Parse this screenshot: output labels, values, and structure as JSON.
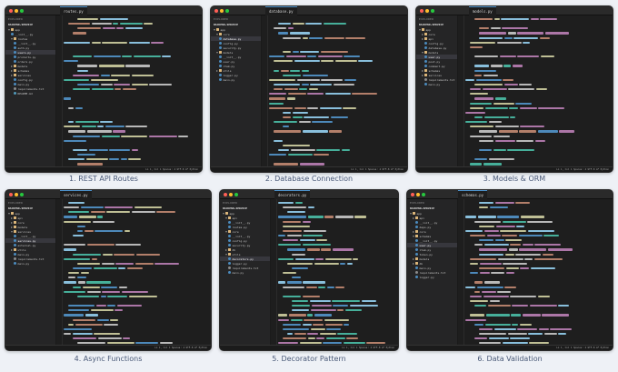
{
  "status_text": "Ln 1, Col 1    Spaces: 4    UTF-8    LF    Python",
  "colors": {
    "red": "#ff5f56",
    "yellow": "#ffbd2e",
    "green": "#27c93f",
    "keyword": "#569cd6",
    "string": "#ce9178",
    "func": "#dcdcaa",
    "comment": "#6a9955"
  },
  "panels": [
    {
      "tab": "routes.py",
      "explorer_title": "EXPLORER",
      "root": "BACKEND-SERVICE",
      "caption": "1. REST API Routes",
      "files": [
        {
          "t": "folder",
          "name": "app",
          "open": true
        },
        {
          "t": "file",
          "name": "__init__.py"
        },
        {
          "t": "folder",
          "name": "routes",
          "open": true
        },
        {
          "t": "file",
          "name": "__init__.py"
        },
        {
          "t": "file",
          "name": "auth.py"
        },
        {
          "t": "file",
          "name": "users.py",
          "active": true
        },
        {
          "t": "file",
          "name": "products.py"
        },
        {
          "t": "file",
          "name": "orders.py"
        },
        {
          "t": "folder",
          "name": "models"
        },
        {
          "t": "folder",
          "name": "schemas"
        },
        {
          "t": "folder",
          "name": "services"
        },
        {
          "t": "file",
          "name": "config.py"
        },
        {
          "t": "file",
          "name": "main.py"
        },
        {
          "t": "file",
          "name": "requirements.txt"
        },
        {
          "t": "file",
          "name": "README.md"
        }
      ]
    },
    {
      "tab": "database.py",
      "explorer_title": "EXPLORER",
      "root": "BACKEND-SERVICE",
      "caption": "2. Database Connection",
      "files": [
        {
          "t": "folder",
          "name": "app",
          "open": true
        },
        {
          "t": "folder",
          "name": "core",
          "open": true
        },
        {
          "t": "file",
          "name": "database.py",
          "active": true
        },
        {
          "t": "file",
          "name": "config.py"
        },
        {
          "t": "file",
          "name": "security.py"
        },
        {
          "t": "folder",
          "name": "models",
          "open": true
        },
        {
          "t": "file",
          "name": "__init__.py"
        },
        {
          "t": "file",
          "name": "user.py"
        },
        {
          "t": "file",
          "name": "item.py"
        },
        {
          "t": "folder",
          "name": "utils"
        },
        {
          "t": "file",
          "name": "logger.py"
        },
        {
          "t": "file",
          "name": "main.py"
        }
      ]
    },
    {
      "tab": "models.py",
      "explorer_title": "EXPLORER",
      "root": "BACKEND-SERVICE",
      "caption": "3. Models & ORM",
      "files": [
        {
          "t": "folder",
          "name": "app",
          "open": true
        },
        {
          "t": "folder",
          "name": "core"
        },
        {
          "t": "folder",
          "name": "api"
        },
        {
          "t": "file",
          "name": "config.py"
        },
        {
          "t": "file",
          "name": "database.py"
        },
        {
          "t": "folder",
          "name": "models",
          "open": true
        },
        {
          "t": "file",
          "name": "user.py",
          "active": true
        },
        {
          "t": "file",
          "name": "post.py"
        },
        {
          "t": "file",
          "name": "comment.py"
        },
        {
          "t": "folder",
          "name": "schemas"
        },
        {
          "t": "folder",
          "name": "services"
        },
        {
          "t": "file",
          "name": "requirements.txt"
        },
        {
          "t": "file",
          "name": "main.py"
        }
      ]
    },
    {
      "tab": "services.py",
      "explorer_title": "EXPLORER",
      "root": "BACKEND-SERVICE",
      "caption": "4. Async Functions",
      "files": [
        {
          "t": "folder",
          "name": "app",
          "open": true
        },
        {
          "t": "folder",
          "name": "api"
        },
        {
          "t": "folder",
          "name": "core"
        },
        {
          "t": "folder",
          "name": "models"
        },
        {
          "t": "folder",
          "name": "services",
          "open": true
        },
        {
          "t": "file",
          "name": "__init__.py"
        },
        {
          "t": "file",
          "name": "services.py",
          "active": true
        },
        {
          "t": "file",
          "name": "external.py"
        },
        {
          "t": "folder",
          "name": "utils"
        },
        {
          "t": "file",
          "name": "main.py"
        },
        {
          "t": "file",
          "name": "requirements.txt"
        },
        {
          "t": "file",
          "name": "main.py"
        }
      ]
    },
    {
      "tab": "decorators.py",
      "explorer_title": "EXPLORER",
      "root": "BACKEND-SERVICE",
      "caption": "5. Decorator Pattern",
      "files": [
        {
          "t": "folder",
          "name": "app",
          "open": true
        },
        {
          "t": "folder",
          "name": "api",
          "open": true
        },
        {
          "t": "file",
          "name": "__init__.py"
        },
        {
          "t": "file",
          "name": "routes.py"
        },
        {
          "t": "folder",
          "name": "core",
          "open": true
        },
        {
          "t": "file",
          "name": "__init__.py"
        },
        {
          "t": "file",
          "name": "config.py"
        },
        {
          "t": "file",
          "name": "security.py"
        },
        {
          "t": "folder",
          "name": "db"
        },
        {
          "t": "folder",
          "name": "utils",
          "open": true
        },
        {
          "t": "file",
          "name": "decorators.py",
          "active": true
        },
        {
          "t": "file",
          "name": "logger.py"
        },
        {
          "t": "file",
          "name": "requirements.txt"
        },
        {
          "t": "file",
          "name": "main.py"
        }
      ]
    },
    {
      "tab": "schemas.py",
      "explorer_title": "EXPLORER",
      "root": "BACKEND-SERVICE",
      "caption": "6. Data Validation",
      "files": [
        {
          "t": "folder",
          "name": "app",
          "open": true
        },
        {
          "t": "folder",
          "name": "api"
        },
        {
          "t": "file",
          "name": "__init__.py"
        },
        {
          "t": "file",
          "name": "deps.py"
        },
        {
          "t": "folder",
          "name": "core"
        },
        {
          "t": "folder",
          "name": "schemas",
          "open": true
        },
        {
          "t": "file",
          "name": "__init__.py"
        },
        {
          "t": "file",
          "name": "user.py",
          "active": true
        },
        {
          "t": "file",
          "name": "item.py"
        },
        {
          "t": "file",
          "name": "token.py"
        },
        {
          "t": "folder",
          "name": "models"
        },
        {
          "t": "folder",
          "name": "db"
        },
        {
          "t": "file",
          "name": "main.py"
        },
        {
          "t": "file",
          "name": "requirements.txt"
        },
        {
          "t": "file",
          "name": "logger.py"
        }
      ]
    }
  ]
}
